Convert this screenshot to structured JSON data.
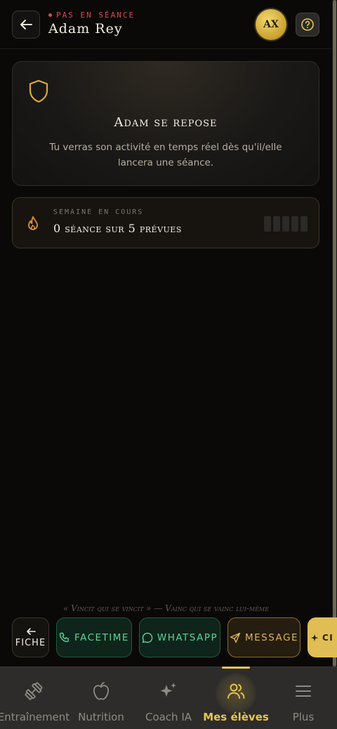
{
  "header": {
    "status": "PAS EN SÉANCE",
    "title": "Adam Rey",
    "avatar_initials": "AX"
  },
  "rest_card": {
    "title": "Adam se repose",
    "description": "Tu verras son activité en temps réel dès qu'il/elle lancera une séance."
  },
  "week_card": {
    "label": "SEMAINE EN COURS",
    "value": "0 séance sur 5 prévues",
    "completed_sessions": 0,
    "planned_sessions": 5
  },
  "quote": "« Vincit qui se vincit » — Vainc qui se vainc lui-même",
  "actions": {
    "fiche_label": "FICHE",
    "facetime_label": "FACETIME",
    "whatsapp_label": "WHATSAPP",
    "message_label": "MESSAGE",
    "gold_label": "CI"
  },
  "nav": {
    "items": [
      {
        "label": "Entraînement",
        "icon": "dumbbell-icon"
      },
      {
        "label": "Nutrition",
        "icon": "apple-icon"
      },
      {
        "label": "Coach IA",
        "icon": "sparkles-icon"
      },
      {
        "label": "Mes élèves",
        "icon": "users-icon",
        "active": true
      },
      {
        "label": "Plus",
        "icon": "menu-icon"
      }
    ]
  },
  "colors": {
    "gold": "#e9c64d",
    "status_red": "#d94848",
    "green": "#5bd497",
    "background": "#0a0908"
  }
}
